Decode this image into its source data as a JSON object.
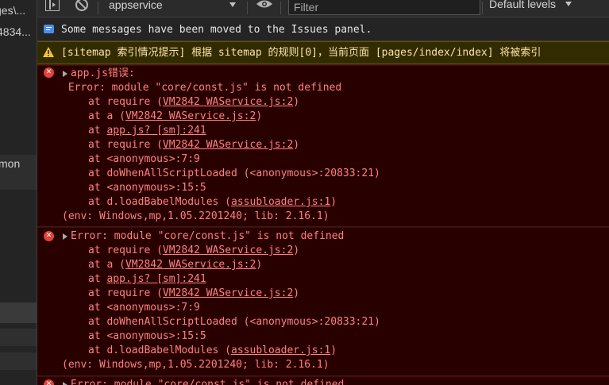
{
  "sidebar": {
    "partial_path": "ges\\...",
    "partial_id": "4834...",
    "partial_label": "mon"
  },
  "toolbar": {
    "context": "appservice",
    "filter_placeholder": "Filter",
    "levels": "Default levels"
  },
  "console": {
    "info_message": "Some messages have been moved to the Issues panel.",
    "warning_message": "[sitemap 索引情况提示] 根据 sitemap 的规则[0]，当前页面 [pages/index/index] 将被索引",
    "errors": [
      {
        "title": "app.js错误:",
        "message": " Error: module \"core/const.js\" is not defined",
        "env": "(env: Windows,mp,1.05.2201240; lib: 2.16.1)"
      },
      {
        "title": "",
        "message": "Error: module \"core/const.js\" is not defined",
        "env": "(env: Windows,mp,1.05.2201240; lib: 2.16.1)"
      },
      {
        "title": "",
        "message": "Error: module \"core/const.js\" is not defined",
        "env": ""
      }
    ],
    "stack": [
      {
        "prefix": "at require (",
        "link": "VM2842 WAService.js:2",
        "suffix": ")"
      },
      {
        "prefix": "at a (",
        "link": "VM2842 WAService.js:2",
        "suffix": ")"
      },
      {
        "prefix": "at ",
        "link": "app.js? [sm]:241",
        "suffix": ""
      },
      {
        "prefix": "at require (",
        "link": "VM2842 WAService.js:2",
        "suffix": ")"
      },
      {
        "prefix": "at <anonymous>:7:9",
        "link": "",
        "suffix": ""
      },
      {
        "prefix": "at doWhenAllScriptLoaded (<anonymous>:20833:21)",
        "link": "",
        "suffix": ""
      },
      {
        "prefix": "at <anonymous>:15:5",
        "link": "",
        "suffix": ""
      },
      {
        "prefix": "at d.loadBabelModules (",
        "link": "assubloader.js:1",
        "suffix": ")"
      }
    ]
  }
}
